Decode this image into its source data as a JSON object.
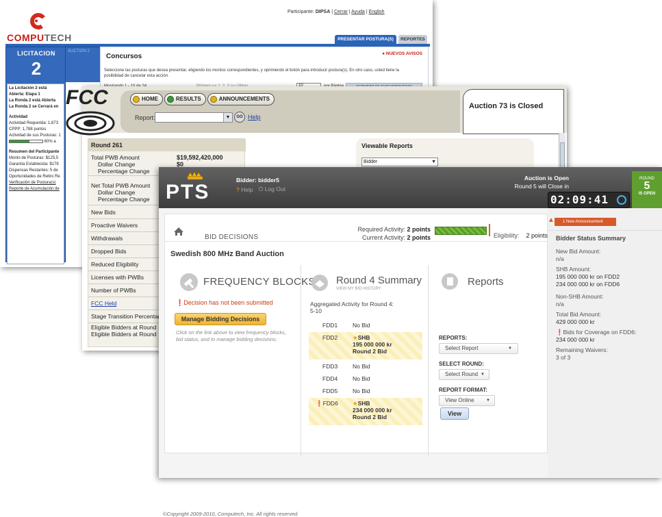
{
  "computech": {
    "logo_word_a": "COMPU",
    "logo_word_b": "TECH",
    "top_prefix": "Participante: ",
    "top_user": "DIPSA",
    "top_links": [
      "Cerrar",
      "Ayuda",
      "English"
    ],
    "tabs": [
      "PRESENTAR POSTURA(S)",
      "REPORTES"
    ],
    "licitacion_label": "LICITACION",
    "licitacion_number": "2",
    "side_caption": "AUCTION 2",
    "status_lines": [
      "La Licitación 2 está Abierta: Etapa 1",
      "La Ronda 2 está Abierta",
      "La Ronda 2 se Cerrará en"
    ],
    "actividad_title": "Actividad",
    "actividad_lines": [
      "Actividad Requerida: 1,873",
      "CPPP: 1,788 puntos",
      "Actividad de sus Posturas: 1"
    ],
    "progress_text": "60% a",
    "resumen_title": "Resumen del Participante",
    "resumen_lines": [
      "Monto de Posturas: $125,5",
      "Garantía Establecida: $178",
      "Dispensas Restantes: 5 de",
      "Oportunidades de Retiro Re"
    ],
    "resumen_links": [
      "Verificación de Postura(s)",
      "Reporte de Acumulación de"
    ],
    "concursos_title": "Concursos",
    "nuevos_avisos": "NUEVOS AVISOS",
    "instructions": "Seleccione las posturas que desea presentar, eligiendo los montos correspondientes, y oprimiendo el botón para introducir postura(s). En otro caso, usted tiene la posibilidad de cancelar esta acción.",
    "mostrando": "Mostrando 1 - 10 de 24",
    "pagination": "Primero << 1, 2, 3 >> Último",
    "per_page_value": "10",
    "per_page_label": "por Página",
    "actividad_button": "ACTIVIDAD DE SU(S) POSTURA(S)"
  },
  "fcc": {
    "logo_text": "FCC",
    "tabs": [
      "HOME",
      "RESULTS",
      "ANNOUNCEMENTS"
    ],
    "report_label": "Report:",
    "go_label": "GO",
    "help_label": "Help",
    "auction_status": "Auction 73 is Closed",
    "round_header": "Round 261",
    "rows": [
      "Total PWB Amount",
      "Dollar Change",
      "Percentage Change",
      "Net Total PWB Amount",
      "Dollar Change",
      "Percentage Change",
      "New Bids",
      "Proactive Waivers",
      "Withdrawals",
      "Dropped Bids",
      "Reduced Eligibility",
      "Licenses with PWBs",
      "Number of PWBs",
      "FCC Held",
      "Stage Transition Percentage",
      "Eligible Bidders at Round",
      "Eligible Bidders at Round"
    ],
    "total_pwb_value": "$19,592,420,000",
    "dollar_change_value": "$0",
    "viewable_reports": "Viewable Reports",
    "viewable_select": "Bidder"
  },
  "pts": {
    "logo_text": "PTS",
    "bidder_label": "Bidder: bidder5",
    "help": "Help",
    "logout": "Log Out",
    "auction_open": "Auction is Open",
    "round_close": "Round 5 will Close in",
    "timer": "02:09:41",
    "round_word": "ROUND",
    "round_number": "5",
    "round_status": "IS OPEN",
    "tab_label": "BID DECISIONS",
    "required_activity_label": "Required Activity:",
    "required_activity_value": "2 points",
    "current_activity_label": "Current Activity:",
    "current_activity_value": "2 points",
    "eligibility_label": "Eligibility:",
    "eligibility_value": "2 points",
    "auction_title": "Swedish 800 MHz Band Auction",
    "frequency_blocks": "FREQUENCY BLOCKS",
    "decision_warning": "Decision has not been submitted",
    "manage_button": "Manage Bidding Decisions",
    "hint": "Click on the link above to view frequency blocks, bid status, and to manage bidding decisions.",
    "round_summary_title": "Round 4 Summary",
    "view_history": "VIEW MY BID HISTORY",
    "aggregated_label": "Aggregated Activity for Round 4:",
    "aggregated_value": "5-10",
    "fdd": [
      {
        "name": "FDD1",
        "line1": "No Bid",
        "line2": "",
        "line3": ""
      },
      {
        "name": "FDD2",
        "line1": "SHB",
        "line2": "195 000 000 kr",
        "line3": "Round 2 Bid"
      },
      {
        "name": "FDD3",
        "line1": "No Bid",
        "line2": "",
        "line3": ""
      },
      {
        "name": "FDD4",
        "line1": "No Bid",
        "line2": "",
        "line3": ""
      },
      {
        "name": "FDD5",
        "line1": "No Bid",
        "line2": "",
        "line3": ""
      },
      {
        "name": "FDD6",
        "line1": "SHB",
        "line2": "234 000 000 kr",
        "line3": "Round 2 Bid"
      }
    ],
    "reports_title": "Reports",
    "reports_label": "REPORTS:",
    "reports_select": "Select Report",
    "select_round_label": "SELECT ROUND:",
    "select_round_value": "Select Round",
    "report_format_label": "REPORT FORMAT:",
    "report_format_value": "View Online",
    "view_button": "View",
    "announcement": "1 New Announcement",
    "status_summary_title": "Bidder Status Summary",
    "summary": {
      "new_bid_label": "New Bid Amount:",
      "new_bid_value": "n/a",
      "shb_label": "SHB Amount:",
      "shb_line1": "195 000 000 kr on FDD2",
      "shb_line2": "234 000 000 kr on FDD6",
      "non_shb_label": "Non-SHB Amount:",
      "non_shb_value": "n/a",
      "total_label": "Total Bid Amount:",
      "total_value": "429 000 000 kr",
      "coverage_label": "Bids for Coverage on FDD6:",
      "coverage_value": "234 000 000 kr",
      "waivers_label": "Remaining Waivers:",
      "waivers_value": "3 of 3"
    },
    "copyright": "©Copyright 2009-2010, Computech, Inc. All rights reserved.",
    "colors": {
      "header": "#4a4a4a",
      "round_green": "#5e9f2f",
      "timer_bg": "#2a2a2a",
      "warning": "#c53a13",
      "button_gold": "#efb530"
    }
  }
}
